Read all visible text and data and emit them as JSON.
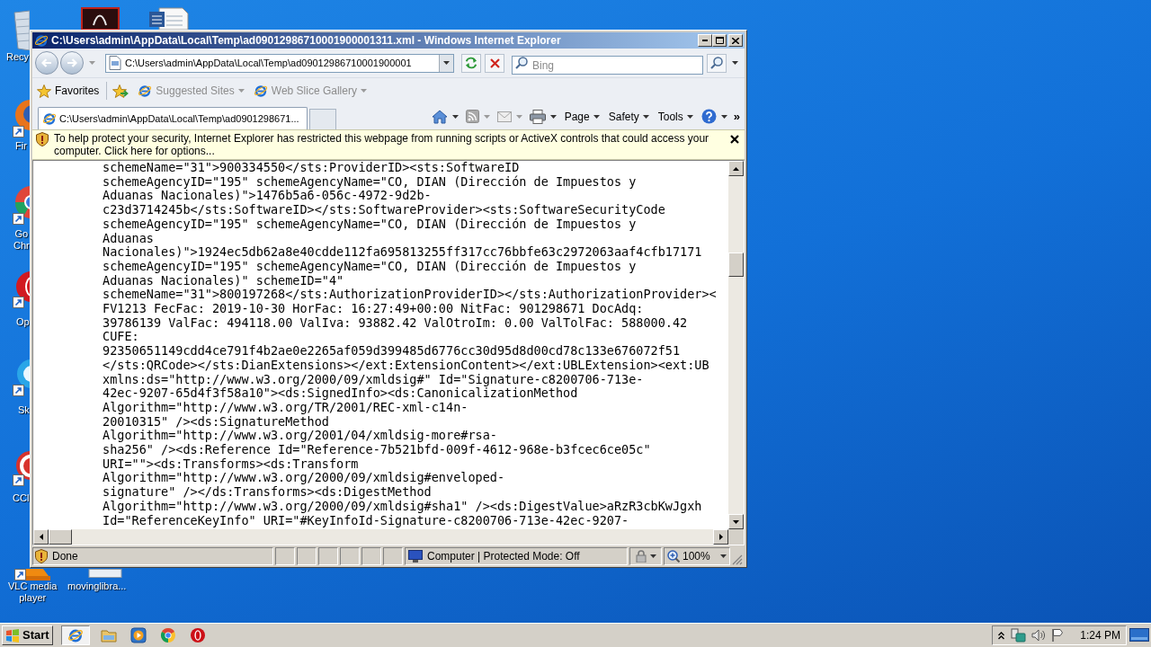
{
  "desktop": {
    "icons": [
      {
        "kind": "recycle-bin",
        "lines": [
          "Recy"
        ]
      },
      {
        "kind": "pdf"
      },
      {
        "kind": "word"
      },
      {
        "kind": "firefox",
        "lines": [
          "Fir"
        ]
      },
      {
        "kind": "chrome",
        "lines": [
          "Go",
          "Chr"
        ]
      },
      {
        "kind": "opera",
        "lines": [
          "Op"
        ]
      },
      {
        "kind": "skype",
        "lines": [
          "Sk"
        ]
      },
      {
        "kind": "ccleaner",
        "lines": [
          "CCl"
        ]
      },
      {
        "kind": "vlc",
        "lines": [
          "VLC media",
          "player"
        ]
      },
      {
        "kind": "file",
        "lines": [
          "movinglibra..."
        ]
      }
    ]
  },
  "window": {
    "title": "C:\\Users\\admin\\AppData\\Local\\Temp\\ad09012986710001900001311.xml - Windows Internet Explorer",
    "address": {
      "value": "C:\\Users\\admin\\AppData\\Local\\Temp\\ad09012986710001900001"
    },
    "search": {
      "placeholder": "Bing"
    },
    "favorites": {
      "label": "Favorites",
      "items": [
        {
          "label": "Suggested Sites",
          "disabled": true
        },
        {
          "label": "Web Slice Gallery",
          "disabled": true
        }
      ]
    },
    "tabs": [
      {
        "label": "C:\\Users\\admin\\AppData\\Local\\Temp\\ad0901298671...",
        "selected": true
      }
    ],
    "commands": [
      {
        "kind": "home",
        "disabled": false
      },
      {
        "kind": "feeds",
        "disabled": true
      },
      {
        "kind": "mail",
        "disabled": true
      },
      {
        "kind": "print",
        "disabled": false
      },
      {
        "kind": "menu",
        "label": "Page"
      },
      {
        "kind": "menu",
        "label": "Safety"
      },
      {
        "kind": "menu",
        "label": "Tools"
      },
      {
        "kind": "help",
        "disabled": false
      },
      {
        "kind": "overflow",
        "label": "»"
      }
    ],
    "info_bar": {
      "message": "To help protect your security, Internet Explorer has restricted this webpage from running scripts or ActiveX controls that could access your computer. Click here for options..."
    },
    "content": {
      "lines": [
        "schemeName=\"31\">900334550</sts:ProviderID><sts:SoftwareID",
        "schemeAgencyID=\"195\" schemeAgencyName=\"CO, DIAN (Dirección de Impuestos y",
        "Aduanas Nacionales)\">1476b5a6-056c-4972-9d2b-",
        "c23d3714245b</sts:SoftwareID></sts:SoftwareProvider><sts:SoftwareSecurityCode",
        "schemeAgencyID=\"195\" schemeAgencyName=\"CO, DIAN (Dirección de Impuestos y",
        "Aduanas",
        "Nacionales)\">1924ec5db62a8e40cdde112fa695813255ff317cc76bbfe63c2972063aaf4cfb17171",
        "schemeAgencyID=\"195\" schemeAgencyName=\"CO, DIAN (Dirección de Impuestos y",
        "Aduanas Nacionales)\" schemeID=\"4\"",
        "schemeName=\"31\">800197268</sts:AuthorizationProviderID></sts:AuthorizationProvider><",
        "FV1213 FecFac: 2019-10-30 HorFac: 16:27:49+00:00 NitFac: 901298671 DocAdq:",
        "39786139 ValFac: 494118.00 ValIva: 93882.42 ValOtroIm: 0.00 ValTolFac: 588000.42",
        "CUFE:",
        "92350651149cdd4ce791f4b2ae0e2265af059d399485d6776cc30d95d8d00cd78c133e676072f51",
        "</sts:QRCode></sts:DianExtensions></ext:ExtensionContent></ext:UBLExtension><ext:UB",
        "xmlns:ds=\"http://www.w3.org/2000/09/xmldsig#\" Id=\"Signature-c8200706-713e-",
        "42ec-9207-65d4f3f58a10\"><ds:SignedInfo><ds:CanonicalizationMethod",
        "Algorithm=\"http://www.w3.org/TR/2001/REC-xml-c14n-",
        "20010315\" /><ds:SignatureMethod",
        "Algorithm=\"http://www.w3.org/2001/04/xmldsig-more#rsa-",
        "sha256\" /><ds:Reference Id=\"Reference-7b521bfd-009f-4612-968e-b3fcec6ce05c\"",
        "URI=\"\"><ds:Transforms><ds:Transform",
        "Algorithm=\"http://www.w3.org/2000/09/xmldsig#enveloped-",
        "signature\" /></ds:Transforms><ds:DigestMethod",
        "Algorithm=\"http://www.w3.org/2000/09/xmldsig#sha1\" /><ds:DigestValue>aRzR3cbKwJgxh",
        "Id=\"ReferenceKeyInfo\" URI=\"#KeyInfoId-Signature-c8200706-713e-42ec-9207-"
      ]
    },
    "status_bar": {
      "text": "Done",
      "zone": "Computer | Protected Mode: Off",
      "zoom": "100%"
    }
  },
  "taskbar": {
    "start": "Start",
    "buttons": [
      {
        "kind": "ie",
        "selected": true
      },
      {
        "kind": "explorer",
        "selected": false
      },
      {
        "kind": "media-player",
        "selected": false
      },
      {
        "kind": "chrome",
        "selected": false
      },
      {
        "kind": "opera",
        "selected": false
      }
    ],
    "clock": "1:24 PM"
  }
}
